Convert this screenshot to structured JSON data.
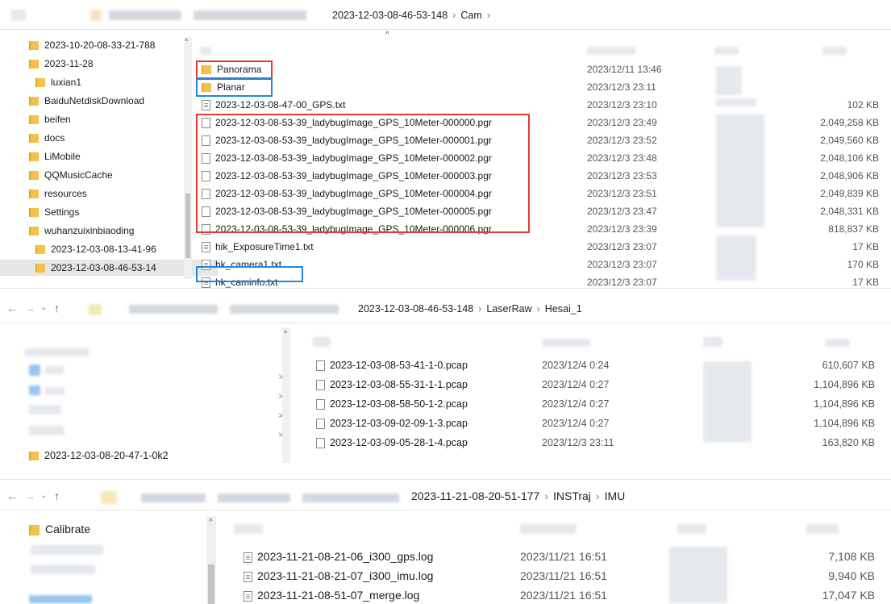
{
  "pane1": {
    "breadcrumb": {
      "folder": "2023-12-03-08-46-53-148",
      "sub": "Cam"
    },
    "sidebar": [
      "2023-10-20-08-33-21-788",
      "2023-11-28",
      "luxian1",
      "BaiduNetdiskDownload",
      "beifen",
      "docs",
      "LiMobile",
      "QQMusicCache",
      "resources",
      "Settings",
      "wuhanzuixinbiaoding",
      "2023-12-03-08-13-41-96",
      "2023-12-03-08-46-53-14"
    ],
    "files": [
      {
        "name": "Panorama",
        "date": "2023/12/11 13:46",
        "size": "",
        "type": "folder"
      },
      {
        "name": "Planar",
        "date": "2023/12/3 23:11",
        "size": "",
        "type": "folder"
      },
      {
        "name": "2023-12-03-08-47-00_GPS.txt",
        "date": "2023/12/3 23:10",
        "size": "102 KB",
        "type": "txt"
      },
      {
        "name": "2023-12-03-08-53-39_ladybugImage_GPS_10Meter-000000.pgr",
        "date": "2023/12/3 23:49",
        "size": "2,049,258 KB",
        "type": "file"
      },
      {
        "name": "2023-12-03-08-53-39_ladybugImage_GPS_10Meter-000001.pgr",
        "date": "2023/12/3 23:52",
        "size": "2,049,560 KB",
        "type": "file"
      },
      {
        "name": "2023-12-03-08-53-39_ladybugImage_GPS_10Meter-000002.pgr",
        "date": "2023/12/3 23:48",
        "size": "2,048,106 KB",
        "type": "file"
      },
      {
        "name": "2023-12-03-08-53-39_ladybugImage_GPS_10Meter-000003.pgr",
        "date": "2023/12/3 23:53",
        "size": "2,048,906 KB",
        "type": "file"
      },
      {
        "name": "2023-12-03-08-53-39_ladybugImage_GPS_10Meter-000004.pgr",
        "date": "2023/12/3 23:51",
        "size": "2,049,839 KB",
        "type": "file"
      },
      {
        "name": "2023-12-03-08-53-39_ladybugImage_GPS_10Meter-000005.pgr",
        "date": "2023/12/3 23:47",
        "size": "2,048,331 KB",
        "type": "file"
      },
      {
        "name": "2023-12-03-08-53-39_ladybugImage_GPS_10Meter-000006.pgr",
        "date": "2023/12/3 23:39",
        "size": "818,837 KB",
        "type": "file"
      },
      {
        "name": "hik_ExposureTime1.txt",
        "date": "2023/12/3 23:07",
        "size": "17 KB",
        "type": "txt"
      },
      {
        "name": "hk_camera1.txt",
        "date": "2023/12/3 23:07",
        "size": "170 KB",
        "type": "txt"
      },
      {
        "name": "hk_caminfo.txt",
        "date": "2023/12/3 23:07",
        "size": "17 KB",
        "type": "txt"
      }
    ]
  },
  "pane2": {
    "breadcrumb": {
      "folder": "2023-12-03-08-46-53-148",
      "sub1": "LaserRaw",
      "sub2": "Hesai_1"
    },
    "sidebar_folder": "2023-12-03-08-20-47-1-0k2",
    "files": [
      {
        "name": "2023-12-03-08-53-41-1-0.pcap",
        "date": "2023/12/4 0:24",
        "size": "610,607 KB"
      },
      {
        "name": "2023-12-03-08-55-31-1-1.pcap",
        "date": "2023/12/4 0:27",
        "size": "1,104,896 KB"
      },
      {
        "name": "2023-12-03-08-58-50-1-2.pcap",
        "date": "2023/12/4 0:27",
        "size": "1,104,896 KB"
      },
      {
        "name": "2023-12-03-09-02-09-1-3.pcap",
        "date": "2023/12/4 0:27",
        "size": "1,104,896 KB"
      },
      {
        "name": "2023-12-03-09-05-28-1-4.pcap",
        "date": "2023/12/3 23:11",
        "size": "163,820 KB"
      }
    ]
  },
  "pane3": {
    "breadcrumb": {
      "folder": "2023-11-21-08-20-51-177",
      "sub1": "INSTraj",
      "sub2": "IMU"
    },
    "sidebar_folder": "Calibrate",
    "files": [
      {
        "name": "2023-11-21-08-21-06_i300_gps.log",
        "date": "2023/11/21 16:51",
        "size": "7,108 KB"
      },
      {
        "name": "2023-11-21-08-21-07_i300_imu.log",
        "date": "2023/11/21 16:51",
        "size": "9,940 KB"
      },
      {
        "name": "2023-11-21-08-51-07_merge.log",
        "date": "2023/11/21 16:51",
        "size": "17,047 KB"
      }
    ]
  },
  "colors": {
    "red_highlight": "#e53935",
    "blue_highlight": "#1e88e5",
    "folder": "#f2c14e"
  }
}
